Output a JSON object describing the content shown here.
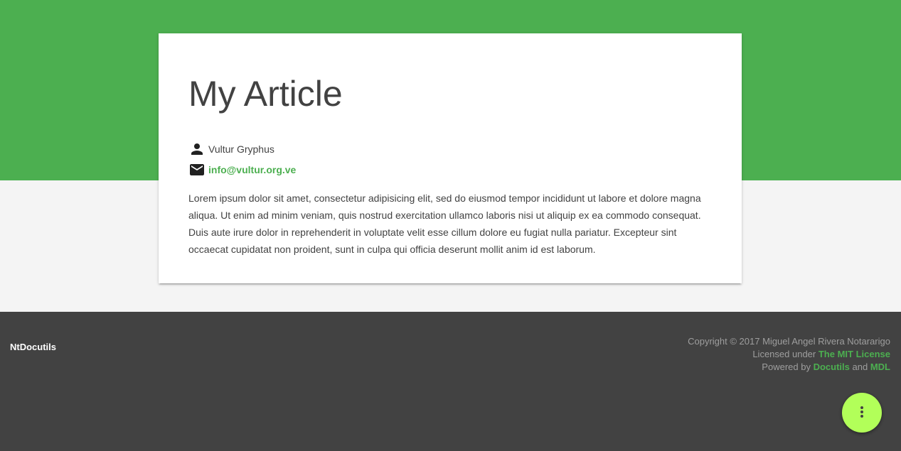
{
  "article": {
    "title": "My Article",
    "author": "Vultur Gryphus",
    "email": "info@vultur.org.ve",
    "body": "Lorem ipsum dolor sit amet, consectetur adipisicing elit, sed do eiusmod tempor incididunt ut labore et dolore magna aliqua. Ut enim ad minim veniam, quis nostrud exercitation ullamco laboris nisi ut aliquip ex ea commodo consequat. Duis aute irure dolor in reprehenderit in voluptate velit esse cillum dolore eu fugiat nulla pariatur. Excepteur sint occaecat cupidatat non proident, sunt in culpa qui officia deserunt mollit anim id est laborum.",
    "icons": {
      "author": "person-icon",
      "email": "mail-icon"
    }
  },
  "footer": {
    "brand": "NtDocutils",
    "copyright": "Copyright © 2017 Miguel Angel Rivera Notararigo",
    "license_prefix": "Licensed under",
    "license_link": "The MIT License",
    "powered_prefix": "Powered by",
    "powered_link_1": "Docutils",
    "powered_and": "and",
    "powered_link_2": "MDL"
  },
  "fab": {
    "icon": "more-vert-icon"
  },
  "colors": {
    "primary": "#4caf50",
    "accent": "#b2ff59",
    "footer_bg": "#424242",
    "page_bg": "#f4f4f4",
    "text": "#424242"
  }
}
